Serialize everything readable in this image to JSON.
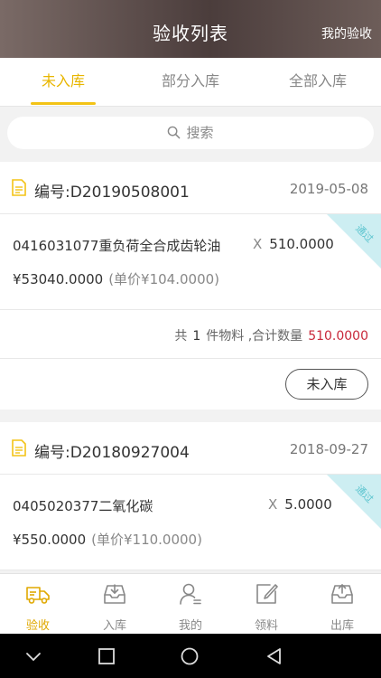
{
  "header": {
    "title": "验收列表",
    "right_link": "我的验收"
  },
  "tabs": [
    {
      "label": "未入库",
      "active": true
    },
    {
      "label": "部分入库",
      "active": false
    },
    {
      "label": "全部入库",
      "active": false
    }
  ],
  "search": {
    "placeholder": "搜索"
  },
  "cards": [
    {
      "code": "编号:D20190508001",
      "date": "2019-05-08",
      "item": {
        "name": "0416031077重负荷全合成齿轮油",
        "qty_prefix": "X",
        "qty": "510.0000",
        "price": "¥53040.0000",
        "unit_price": "(单价¥104.0000)",
        "ribbon": "通过"
      },
      "summary": {
        "prefix": "共",
        "count": "1",
        "middle": "件物料 ,合计数量",
        "total": "510.0000"
      },
      "button": "未入库"
    },
    {
      "code": "编号:D20180927004",
      "date": "2018-09-27",
      "item": {
        "name": "0405020377二氧化碳",
        "qty_prefix": "X",
        "qty": "5.0000",
        "price": "¥550.0000",
        "unit_price": "(单价¥110.0000)",
        "ribbon": "通过"
      }
    }
  ],
  "nav": [
    {
      "label": "验收",
      "icon": "truck-icon",
      "active": true
    },
    {
      "label": "入库",
      "icon": "inbox-in-icon",
      "active": false
    },
    {
      "label": "我的",
      "icon": "user-icon",
      "active": false
    },
    {
      "label": "领料",
      "icon": "edit-icon",
      "active": false
    },
    {
      "label": "出库",
      "icon": "inbox-out-icon",
      "active": false
    }
  ],
  "colors": {
    "accent": "#f3c316",
    "danger": "#c8283a",
    "ribbon": "#cdeef2"
  }
}
